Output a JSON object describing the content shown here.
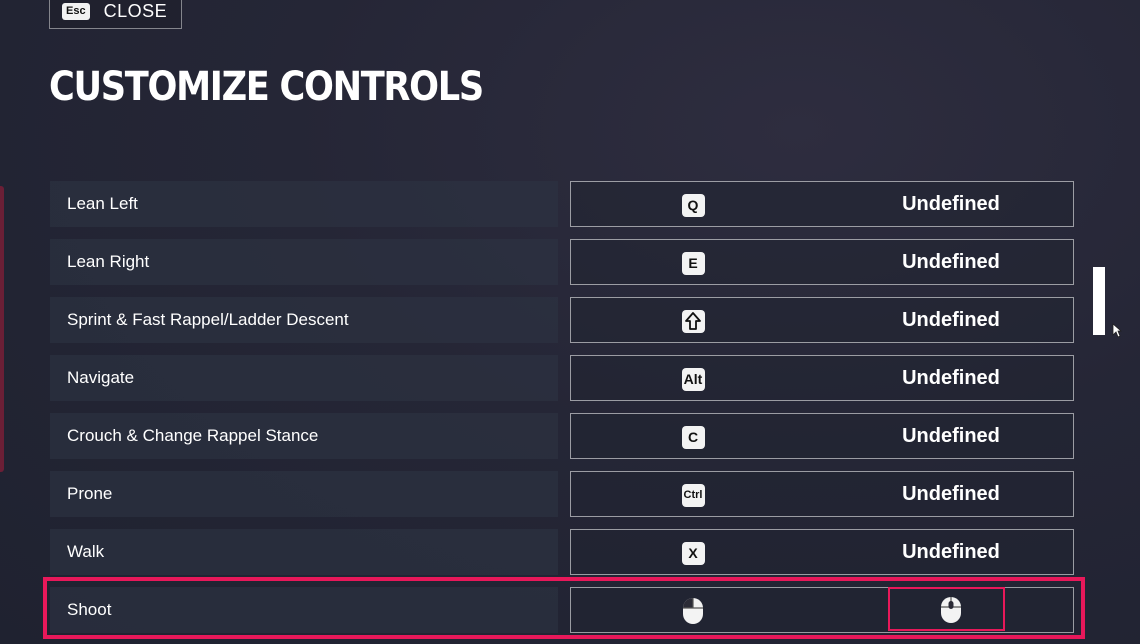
{
  "close": {
    "key": "Esc",
    "label": "CLOSE"
  },
  "title": "CUSTOMIZE CONTROLS",
  "rows": [
    {
      "action": "Lean Left",
      "primary": "Q",
      "alternate": "Undefined"
    },
    {
      "action": "Lean Right",
      "primary": "E",
      "alternate": "Undefined"
    },
    {
      "action": "Sprint & Fast Rappel/Ladder Descent",
      "primary": "shift-arrow-icon",
      "alternate": "Undefined"
    },
    {
      "action": "Navigate",
      "primary": "Alt",
      "alternate": "Undefined"
    },
    {
      "action": "Crouch & Change Rappel Stance",
      "primary": "C",
      "alternate": "Undefined"
    },
    {
      "action": "Prone",
      "primary": "Ctrl",
      "alternate": "Undefined"
    },
    {
      "action": "Walk",
      "primary": "X",
      "alternate": "Undefined"
    },
    {
      "action": "Shoot",
      "primary": "mouse-left-button-icon",
      "alternate": "mouse-middle-button-icon"
    }
  ],
  "colors": {
    "highlight": "#e8185a",
    "background": "#252636"
  }
}
